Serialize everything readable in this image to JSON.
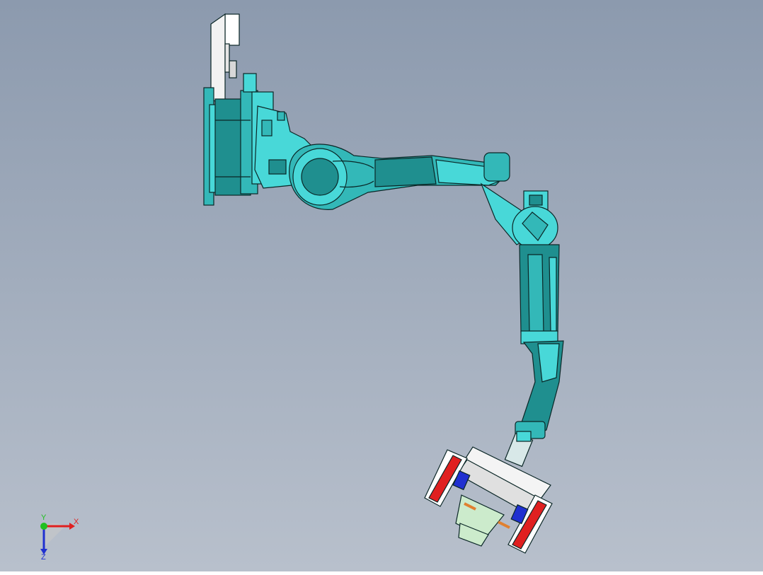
{
  "viewport": {
    "background_top": "#8c9aae",
    "background_bottom": "#b8c0cc",
    "part_color": "#33b8b8",
    "part_dark": "#1f8f8f",
    "part_light": "#48d8d8",
    "edge_color": "#0a2626"
  },
  "triad": {
    "x_label": "X",
    "y_label": "Y",
    "z_label": "Z",
    "x_color": "#e02020",
    "y_color": "#20c020",
    "z_color": "#2030d0"
  }
}
